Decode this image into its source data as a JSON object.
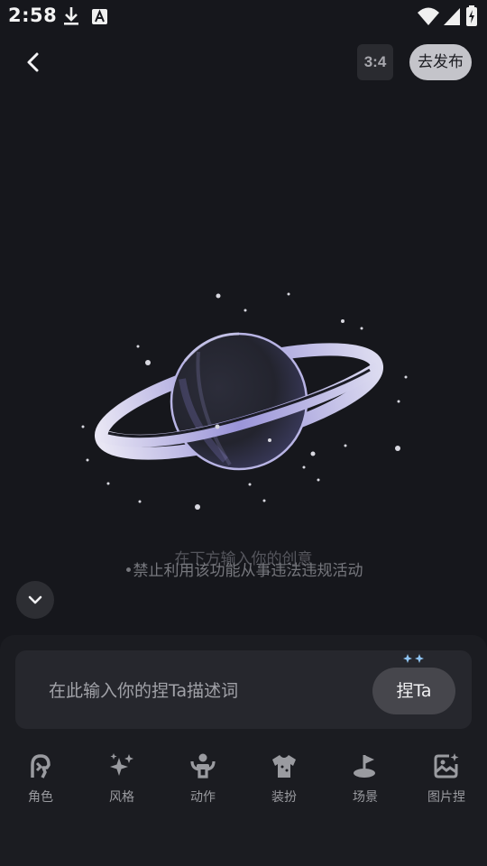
{
  "status_bar": {
    "time": "2:58"
  },
  "header": {
    "ratio_label": "3:4",
    "publish_label": "去发布"
  },
  "canvas": {
    "hint_primary": "在下方输入你的创意",
    "hint_secondary": "•禁止利用该功能从事违法违规活动"
  },
  "prompt": {
    "placeholder": "在此输入你的捏Ta描述词",
    "submit_label": "捏Ta"
  },
  "tabs": [
    {
      "label": "角色",
      "icon": "character-icon"
    },
    {
      "label": "风格",
      "icon": "style-sparkle-icon"
    },
    {
      "label": "动作",
      "icon": "action-icon"
    },
    {
      "label": "装扮",
      "icon": "outfit-icon"
    },
    {
      "label": "场景",
      "icon": "scene-icon"
    },
    {
      "label": "图片捏",
      "icon": "image-pinch-icon"
    }
  ]
}
